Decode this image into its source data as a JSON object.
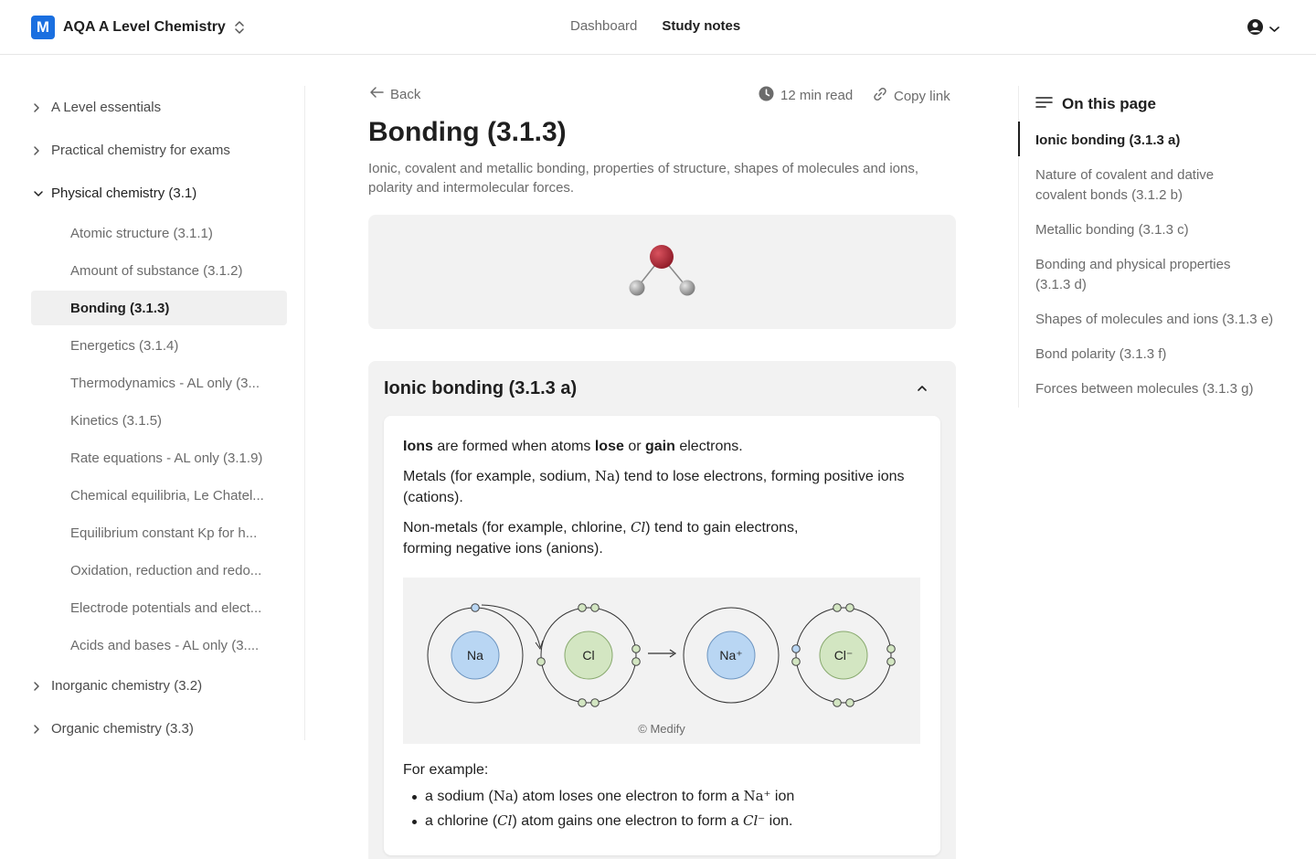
{
  "header": {
    "brand_logo": "M",
    "brand_name": "AQA A Level Chemistry",
    "nav": [
      "Dashboard",
      "Study notes"
    ],
    "active_nav": "Study notes",
    "accent": "#1a6fe0"
  },
  "sidebar": {
    "sections": [
      {
        "label": "A Level essentials",
        "open": false
      },
      {
        "label": "Practical chemistry for exams",
        "open": false
      },
      {
        "label": "Physical chemistry (3.1)",
        "open": true
      },
      {
        "label": "Inorganic chemistry (3.2)",
        "open": false
      },
      {
        "label": "Organic chemistry (3.3)",
        "open": false
      }
    ],
    "physical_items": [
      "Atomic structure (3.1.1)",
      "Amount of substance (3.1.2)",
      "Bonding (3.1.3)",
      "Energetics (3.1.4)",
      "Thermodynamics - AL only (3...",
      "Kinetics (3.1.5)",
      "Rate equations - AL only (3.1.9)",
      "Chemical equilibria, Le Chatel...",
      "Equilibrium constant Kp for h...",
      "Oxidation, reduction and redo...",
      "Electrode potentials and elect...",
      "Acids and bases - AL only (3...."
    ],
    "active_item": "Bonding (3.1.3)"
  },
  "main": {
    "back_label": "Back",
    "read_time": "12 min read",
    "copy_link": "Copy link",
    "title": "Bonding (3.1.3)",
    "description": "Ionic, covalent and metallic bonding, properties of structure, shapes of molecules and ions, polarity and intermolecular forces.",
    "section": {
      "title": "Ionic bonding (3.1.3 a)",
      "p1": {
        "a": "Ions",
        "b": " are formed when atoms ",
        "c": "lose",
        "d": " or ",
        "e": "gain",
        "f": " electrons."
      },
      "p2": {
        "a": "Metals (for example, sodium, ",
        "chem": "Na",
        "b": ") tend to lose electrons, forming positive ions (cations)."
      },
      "p3": {
        "a": "Non-metals (for example, chlorine, ",
        "chem": "Cl",
        "b": ") tend to gain electrons, forming negative ions (anions)."
      },
      "diagram": {
        "atoms": [
          "Na",
          "Cl",
          "Na⁺",
          "Cl⁻"
        ],
        "copyright": "© Medify",
        "colors": {
          "na": "#b9d6f3",
          "cl": "#d3e6c2"
        }
      },
      "for_example": "For example:",
      "bullets": [
        {
          "a": "a sodium (",
          "chem1": "Na",
          "b": ") atom loses one electron to form a ",
          "chem2": "Na⁺",
          "c": " ion"
        },
        {
          "a": "a chlorine (",
          "chem1": "Cl",
          "b": ") atom gains one electron to form a ",
          "chem2": "Cl⁻",
          "c": " ion."
        }
      ]
    }
  },
  "toc": {
    "title": "On this page",
    "items": [
      "Ionic bonding (3.1.3 a)",
      "Nature of covalent and dative covalent bonds (3.1.2 b)",
      "Metallic bonding (3.1.3 c)",
      "Bonding and physical properties (3.1.3 d)",
      "Shapes of molecules and ions (3.1.3 e)",
      "Bond polarity (3.1.3 f)",
      "Forces between molecules (3.1.3 g)"
    ],
    "active": "Ionic bonding (3.1.3 a)"
  }
}
